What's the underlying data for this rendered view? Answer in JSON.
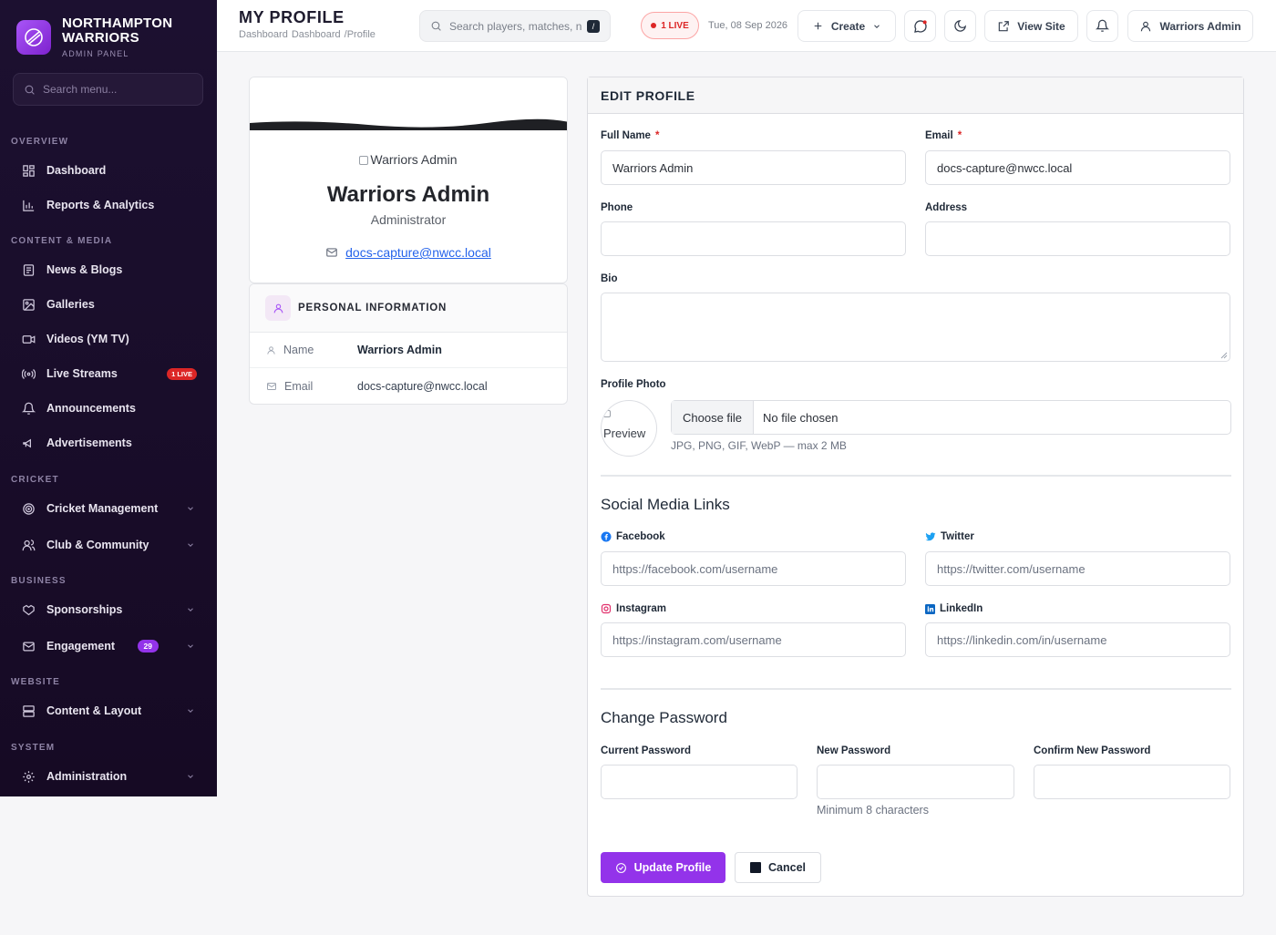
{
  "brand": {
    "name_line1": "NORTHAMPTON",
    "name_line2": "WARRIORS",
    "subtitle": "ADMIN PANEL"
  },
  "sidebar": {
    "search_placeholder": "Search menu...",
    "sections": {
      "overview": "OVERVIEW",
      "content_media": "CONTENT & MEDIA",
      "cricket": "CRICKET",
      "business": "BUSINESS",
      "website": "WEBSITE",
      "system": "SYSTEM"
    },
    "items": {
      "dashboard": "Dashboard",
      "reports": "Reports & Analytics",
      "news": "News & Blogs",
      "galleries": "Galleries",
      "videos": "Videos (YM TV)",
      "live_streams": "Live Streams",
      "live_badge": "1 LIVE",
      "announcements": "Announcements",
      "advertisements": "Advertisements",
      "cricket_mgmt": "Cricket Management",
      "club": "Club & Community",
      "sponsorships": "Sponsorships",
      "engagement": "Engagement",
      "engagement_count": "29",
      "content_layout": "Content & Layout",
      "administration": "Administration"
    }
  },
  "topbar": {
    "title": "MY PROFILE",
    "breadcrumb": [
      "Dashboard",
      "Dashboard",
      "/Profile"
    ],
    "search_placeholder": "Search players, matches, n",
    "kbd": "/",
    "live_label": "1 LIVE",
    "date": "Tue, 08 Sep 2026",
    "create_label": "Create",
    "view_site_label": "View Site",
    "user_label": "Warriors Admin"
  },
  "profile_card": {
    "avatar_alt": "Warriors Admin",
    "name": "Warriors Admin",
    "role": "Administrator",
    "email": "docs-capture@nwcc.local"
  },
  "personal_info": {
    "heading": "PERSONAL INFORMATION",
    "name_label": "Name",
    "name_value": "Warriors Admin",
    "email_label": "Email",
    "email_value": "docs-capture@nwcc.local"
  },
  "form": {
    "heading": "EDIT PROFILE",
    "full_name_label": "Full Name",
    "full_name_value": "Warriors Admin",
    "email_label": "Email",
    "email_value": "docs-capture@nwcc.local",
    "required_mark": "*",
    "phone_label": "Phone",
    "address_label": "Address",
    "bio_label": "Bio",
    "photo_label": "Profile Photo",
    "photo_preview_alt": "Preview",
    "choose_file": "Choose file",
    "no_file": "No file chosen",
    "photo_hint": "JPG, PNG, GIF, WebP — max 2 MB",
    "social_title": "Social Media Links",
    "facebook_label": "Facebook",
    "facebook_placeholder": "https://facebook.com/username",
    "twitter_label": "Twitter",
    "twitter_placeholder": "https://twitter.com/username",
    "instagram_label": "Instagram",
    "instagram_placeholder": "https://instagram.com/username",
    "linkedin_label": "LinkedIn",
    "linkedin_placeholder": "https://linkedin.com/in/username",
    "password_title": "Change Password",
    "current_password_label": "Current Password",
    "new_password_label": "New Password",
    "new_password_hint": "Minimum 8 characters",
    "confirm_password_label": "Confirm New Password",
    "update_button": "Update Profile",
    "cancel_button": "Cancel"
  },
  "colors": {
    "accent": "#9333ea",
    "sidebar_bg": "#1c1030",
    "live": "#dc2626"
  }
}
